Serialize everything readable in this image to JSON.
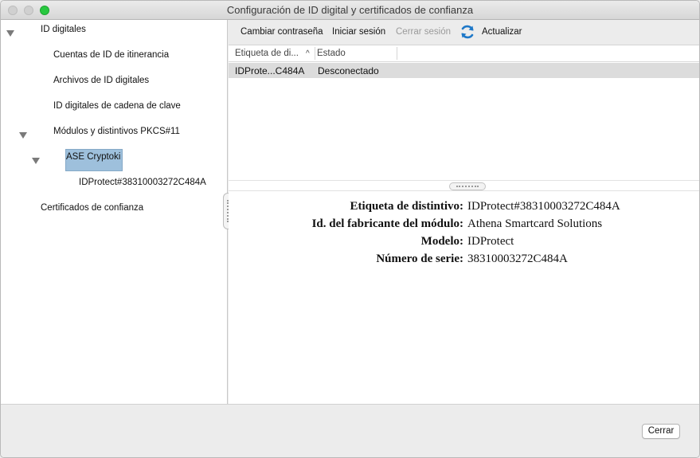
{
  "window": {
    "title": "Configuración de ID digital y certificados de confianza"
  },
  "sidebar": {
    "items": [
      {
        "label": "ID digitales"
      },
      {
        "label": "Cuentas de ID de itinerancia"
      },
      {
        "label": "Archivos de ID digitales"
      },
      {
        "label": "ID digitales de cadena de clave"
      },
      {
        "label": "Módulos y distintivos PKCS#11"
      },
      {
        "label": "ASE Cryptoki"
      },
      {
        "label": "IDProtect#38310003272C484A"
      },
      {
        "label": "Certificados de confianza"
      }
    ],
    "selected": "ASE Cryptoki"
  },
  "toolbar": {
    "change_password": "Cambiar contraseña",
    "login": "Iniciar sesión",
    "logout": "Cerrar sesión",
    "refresh": "Actualizar"
  },
  "table": {
    "columns": [
      "Etiqueta de di...",
      "Estado"
    ],
    "rows": [
      {
        "label": "IDProte...C484A",
        "status": "Desconectado"
      }
    ]
  },
  "details": {
    "token_label_key": "Etiqueta de distintivo:",
    "token_label_value": "IDProtect#38310003272C484A",
    "manufacturer_key": "Id. del fabricante del módulo:",
    "manufacturer_value": "Athena Smartcard Solutions",
    "model_key": "Modelo:",
    "model_value": "IDProtect",
    "serial_key": "Número de serie:",
    "serial_value": "38310003272C484A"
  },
  "footer": {
    "close_label": "Cerrar"
  },
  "colors": {
    "selection": "#9ec0dc",
    "row_highlight": "#dcdcdc",
    "zoom_button": "#28c840",
    "refresh_icon": "#1e78c8"
  }
}
